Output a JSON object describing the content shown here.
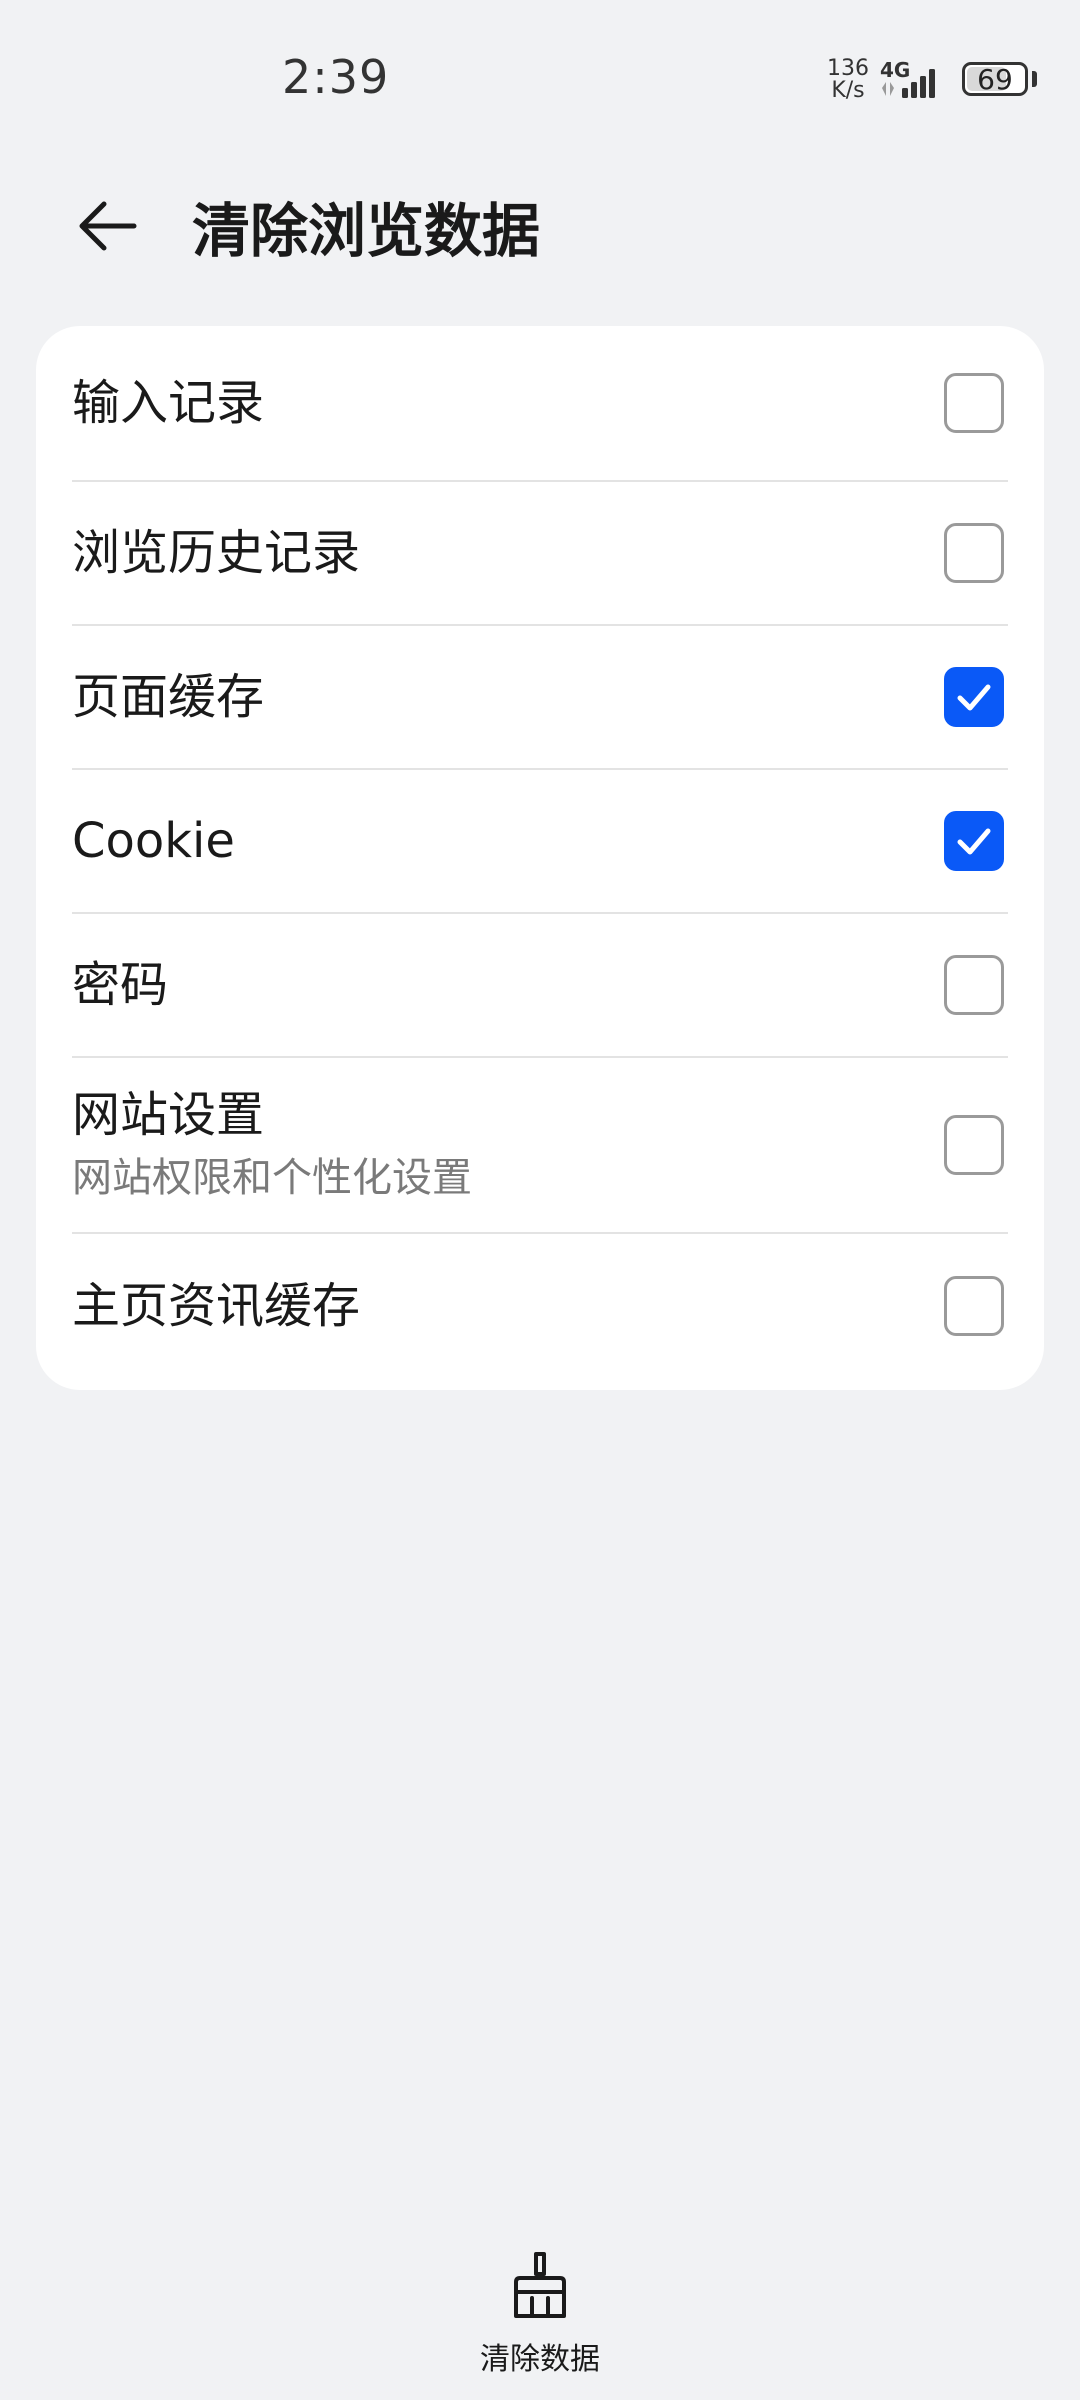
{
  "status_bar": {
    "time": "2:39",
    "net_speed_value": "136",
    "net_speed_unit": "K/s",
    "network_type": "4G",
    "battery_level": "69",
    "battery_fraction": 0.69,
    "icons": [
      "signal-icon",
      "battery-icon"
    ]
  },
  "header": {
    "title": "清除浏览数据",
    "back_icon": "arrow-left-icon"
  },
  "options": [
    {
      "label": "输入记录",
      "sub": "",
      "checked": false
    },
    {
      "label": "浏览历史记录",
      "sub": "",
      "checked": false
    },
    {
      "label": "页面缓存",
      "sub": "",
      "checked": true
    },
    {
      "label": "Cookie",
      "sub": "",
      "checked": true
    },
    {
      "label": "密码",
      "sub": "",
      "checked": false
    },
    {
      "label": "网站设置",
      "sub": "网站权限和个性化设置",
      "checked": false
    },
    {
      "label": "主页资讯缓存",
      "sub": "",
      "checked": false
    }
  ],
  "bottom_action": {
    "label": "清除数据",
    "icon": "broom-icon"
  },
  "colors": {
    "accent": "#0a59f7",
    "background": "#f1f2f4",
    "card": "#ffffff"
  }
}
